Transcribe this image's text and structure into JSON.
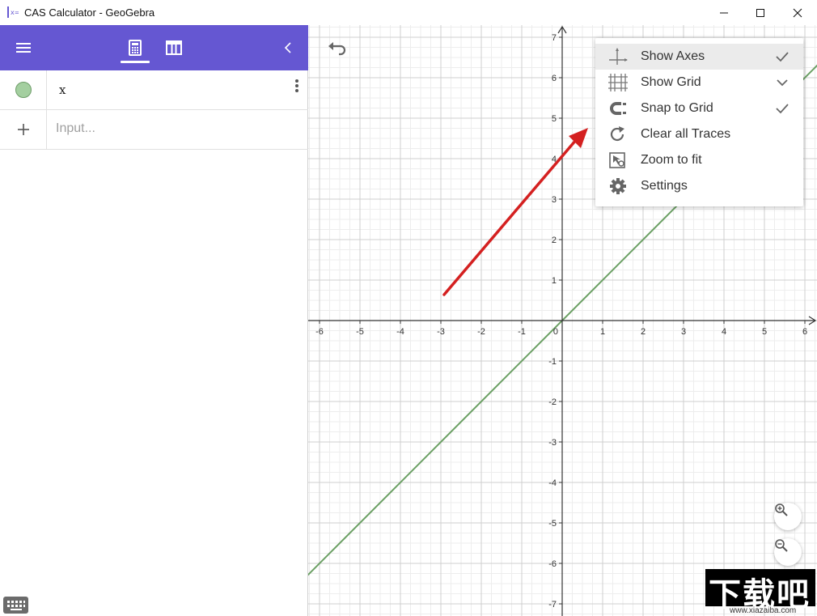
{
  "window": {
    "title": "CAS Calculator - GeoGebra"
  },
  "toolbar": {
    "menu_icon": "hamburger-icon",
    "tabs": [
      {
        "name": "algebra",
        "icon": "calculator-icon",
        "selected": true
      },
      {
        "name": "table",
        "icon": "table-icon",
        "selected": false
      }
    ],
    "collapse_icon": "chevron-left-icon",
    "accent_color": "#6557d2"
  },
  "algebra": {
    "items": [
      {
        "expression": "x",
        "color": "#a4cfa0"
      }
    ],
    "input_placeholder": "Input..."
  },
  "graph": {
    "x_ticks": [
      "-6",
      "-5",
      "-4",
      "-3",
      "-2",
      "-1",
      "0",
      "1",
      "2",
      "3",
      "4",
      "5",
      "6"
    ],
    "y_ticks": [
      "7",
      "6",
      "5",
      "4",
      "3",
      "2",
      "1",
      "-1",
      "-2",
      "-3",
      "-4",
      "-5",
      "-6",
      "-7"
    ],
    "x_range": [
      -6.3,
      6.2
    ],
    "y_range": [
      -7.3,
      7.3
    ],
    "line_color": "#6a9f63",
    "arrow_color": "#d42020"
  },
  "context_menu": {
    "items": [
      {
        "label": "Show Axes",
        "icon": "axes-icon",
        "checked": true
      },
      {
        "label": "Show Grid",
        "icon": "grid-icon",
        "checked": true
      },
      {
        "label": "Snap to Grid",
        "icon": "magnet-icon",
        "checked": true
      },
      {
        "label": "Clear all Traces",
        "icon": "refresh-icon",
        "checked": false
      },
      {
        "label": "Zoom to fit",
        "icon": "zoom-fit-icon",
        "checked": false
      },
      {
        "label": "Settings",
        "icon": "gear-icon",
        "checked": false
      }
    ]
  },
  "watermark": {
    "text": "下载吧",
    "url": "www.xiazaiba.com"
  }
}
